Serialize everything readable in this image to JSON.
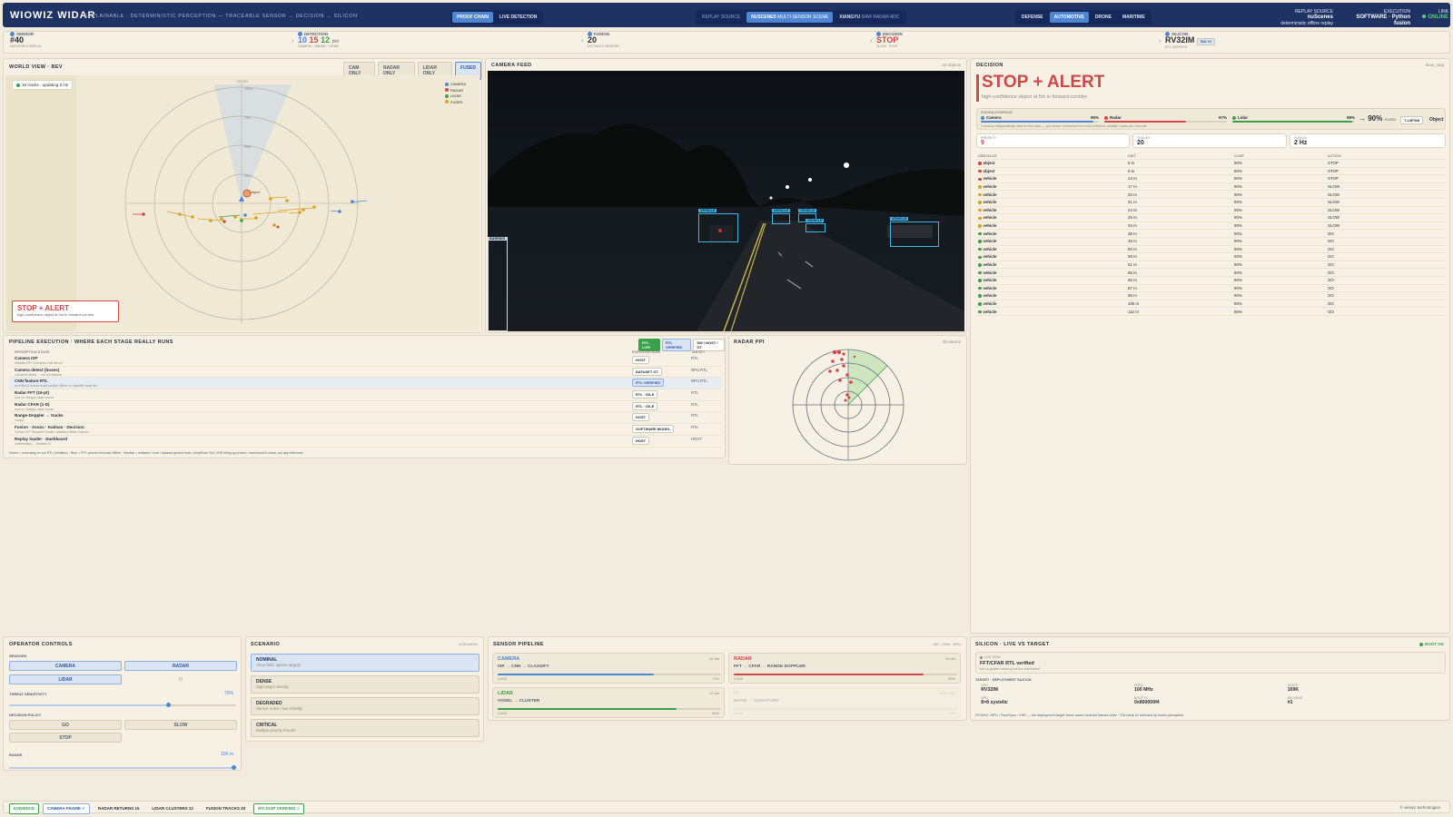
{
  "header": {
    "brand": "WIOWIZ WIDAR",
    "tagline": "EXPLAINABLE · DETERMINISTIC PERCEPTION — TRACEABLE SENSOR → DECISION → SILICON",
    "modes": [
      "PROOF CHAIN",
      "LIVE DETECTION"
    ],
    "replay_label": "REPLAY SOURCE",
    "replay": [
      "NUSCENES",
      "multi-sensor scene",
      "XIANGYU",
      "raw radar ADC"
    ],
    "domains": [
      "DEFENSE",
      "AUTOMOTIVE",
      "DRONE",
      "MARITIME"
    ],
    "replay_source": {
      "label": "REPLAY SOURCE",
      "value": "nuScenes",
      "sub": "deterministic offline replay"
    },
    "execution": {
      "label": "EXECUTION",
      "value": "SOFTWARE · Python fusion"
    },
    "link": {
      "label": "LINK",
      "value": "ONLINE"
    }
  },
  "chain": [
    {
      "label": "SENSOR",
      "value": "#40",
      "sub": "NUSCENES REPLAY"
    },
    {
      "label": "DETECTION",
      "v1": "10",
      "v2": "15",
      "v3": "12",
      "unit": "det",
      "sub": "CAMERA · RADAR · LIDAR"
    },
    {
      "label": "FUSION",
      "value": "20",
      "sub": "DST MULTI-SENSOR"
    },
    {
      "label": "DECISION",
      "value": "STOP",
      "sub": "SLOW · STOP"
    },
    {
      "label": "SILICON",
      "value": "RV32IM",
      "badge": "SIU #1",
      "sub": "RTL VERIFIED"
    }
  ],
  "world": {
    "title": "WORLD VIEW · BEV",
    "filters": [
      "CAM ONLY",
      "RADAR ONLY",
      "LIDAR ONLY",
      "FUSED"
    ],
    "status": "18 tracks · updating 2 Hz",
    "front": "FRONT",
    "rings": [
      "100m",
      "75m",
      "50m",
      "25m"
    ],
    "legend": [
      "CAMERA",
      "RADAR",
      "LIDAR",
      "FUSED"
    ],
    "alert": "STOP + ALERT",
    "alert_sub": "high-confidence object at 5m in forward corridor",
    "target": "object"
  },
  "camera": {
    "title": "CAMERA FEED",
    "count": "10 objects",
    "labels": [
      "VEHICLE",
      "VEHICLE",
      "VEHICLE",
      "VEHICLE",
      "VEHICLE",
      "BARRIER"
    ]
  },
  "decision": {
    "title": "DECISION",
    "tag": "slow_stop",
    "headline": "STOP + ALERT",
    "sub": "high-confidence object at 5m in forward corridor",
    "evidence_label": "FUSION EVIDENCE",
    "cam": "Camera",
    "cam_pct": "95%",
    "radar": "Radar",
    "radar_pct": "67%",
    "lidar": "Lidar",
    "lidar_pct": "98%",
    "fused": "90%",
    "fused_lbl": "FUSED",
    "track": "T-14f008",
    "obj": "Object",
    "note": "3 sensors independently observe this track — per-sensor confidence from real nuScenes visibility / radar pts / lidar pts",
    "stats": [
      {
        "l": "PRIORITY",
        "v": "9"
      },
      {
        "l": "TRACKS",
        "v": "20"
      },
      {
        "l": "FUSION",
        "v": "2 Hz"
      }
    ],
    "cols": [
      "OBSTACLE",
      "DIST",
      "CONF",
      "ACTION"
    ],
    "rows": [
      [
        "object",
        "6 m",
        "90%",
        "STOP"
      ],
      [
        "object",
        "8 m",
        "90%",
        "STOP"
      ],
      [
        "vehicle",
        "14 m",
        "90%",
        "STOP"
      ],
      [
        "vehicle",
        "17 m",
        "90%",
        "SLOW"
      ],
      [
        "vehicle",
        "20 m",
        "90%",
        "SLOW"
      ],
      [
        "vehicle",
        "21 m",
        "90%",
        "SLOW"
      ],
      [
        "vehicle",
        "24 m",
        "90%",
        "SLOW"
      ],
      [
        "vehicle",
        "25 m",
        "90%",
        "SLOW"
      ],
      [
        "vehicle",
        "34 m",
        "90%",
        "SLOW"
      ],
      [
        "vehicle",
        "38 m",
        "90%",
        "GO"
      ],
      [
        "vehicle",
        "45 m",
        "90%",
        "GO"
      ],
      [
        "vehicle",
        "50 m",
        "90%",
        "GO"
      ],
      [
        "vehicle",
        "56 m",
        "90%",
        "GO"
      ],
      [
        "vehicle",
        "61 m",
        "90%",
        "GO"
      ],
      [
        "vehicle",
        "65 m",
        "90%",
        "GO"
      ],
      [
        "vehicle",
        "66 m",
        "90%",
        "GO"
      ],
      [
        "vehicle",
        "87 m",
        "90%",
        "GO"
      ],
      [
        "vehicle",
        "96 m",
        "90%",
        "GO"
      ],
      [
        "vehicle",
        "105 m",
        "90%",
        "GO"
      ],
      [
        "vehicle",
        "112 m",
        "90%",
        "GO"
      ]
    ]
  },
  "pipeline": {
    "title": "PIPELINE EXECUTION · WHERE EACH STAGE REALLY RUNS",
    "badges": [
      "RTL LIVE",
      "RTL VERIFIED",
      "SW / HOST / GT"
    ],
    "cols": [
      "PERCEPTION STAGE",
      "EXECUTED NOW",
      "TARGET"
    ],
    "rows": [
      [
        "Camera ISP",
        "software ISP, nuScenes; real sensor",
        "HOST",
        "RTL"
      ],
      [
        "Camera detect (boxes)",
        "nuScenes labels → not run detector",
        "DATASET GT",
        "NPU RTL"
      ],
      [
        "CNN feature RTL",
        "conv/ReLU feature maps verified offline; no classifier head live",
        "RTL VERIFIED",
        "NPU RTL"
      ],
      [
        "Radar FFT (16-pt)",
        "runs on Xiangyu radar source",
        "RTL · IDLE",
        "RTL"
      ],
      [
        "Radar CFAR (1-D)",
        "runs on Xiangyu radar source",
        "RTL · IDLE",
        "RTL"
      ],
      [
        "Range-Doppler → tracks",
        "numpy",
        "HOST",
        "RTL"
      ],
      [
        "Fusion · Assoc · Kalman · Decision",
        "Python DST Dempster-Shafer; validated offline; Kalman",
        "SOFTWARE MODEL",
        "RTL"
      ],
      [
        "Replay loader · Dashboard",
        "orchestration → browser UI",
        "HOST",
        "HOST"
      ]
    ],
    "foot": "Green = executing on our RTL (Verilator) · Blue = RTL proven bit-exact offline · Neutral = software / host / dataset ground truth. DeepFuse SoC VHE bring-up proven: reset/clock/X-clean, not app inference."
  },
  "radar_ppi": {
    "title": "RADAR PPI",
    "count": "15 returns"
  },
  "controls": {
    "title": "OPERATOR CONTROLS",
    "sensors_lbl": "SENSORS",
    "sensors": [
      "CAMERA",
      "RADAR",
      "LIDAR",
      "IR"
    ],
    "threat_lbl": "THREAT SENSITIVITY",
    "threat": "70%",
    "threat_level": 0.7,
    "policy_lbl": "DECISION POLICY",
    "policy": [
      "GO",
      "SLOW",
      "STOP"
    ],
    "range_lbl": "RANGE",
    "range": "100 m",
    "range_level": 1.0
  },
  "scenario": {
    "title": "SCENARIO",
    "tag": "SCENARIO",
    "items": [
      {
        "n": "NOMINAL",
        "d": "Clear field, sparse targets"
      },
      {
        "n": "DENSE",
        "d": "High target density"
      },
      {
        "n": "DEGRADED",
        "d": "Sensor noise / low visibility"
      },
      {
        "n": "CRITICAL",
        "d": "Multiple priority threats"
      }
    ]
  },
  "sensor_pipeline": {
    "title": "SENSOR PIPELINE",
    "tag": "ISP · CNN · NPU",
    "cards": [
      {
        "n": "CAMERA",
        "c": "10 det",
        "p": "ISP → CNN → CLASSIFY",
        "l": "LOAD",
        "v": "70%",
        "lv": 0.7,
        "col": "#4f86d4"
      },
      {
        "n": "RADAR",
        "c": "15 det",
        "p": "FFT → CFAR → RANGE-DOPPLER",
        "l": "LOAD",
        "v": "85%",
        "lv": 0.85,
        "col": "#d04848"
      },
      {
        "n": "LIDAR",
        "c": "12 det",
        "p": "VOXEL → CLUSTER",
        "l": "LOAD",
        "v": "80%",
        "lv": 0.8,
        "col": "#3aa04a"
      },
      {
        "n": "IR",
        "c": "OFFLINE",
        "p": "BEAM → SIGNATURE",
        "l": "LOAD",
        "v": "0%",
        "lv": 0,
        "col": "#cfc8b3"
      }
    ]
  },
  "silicon": {
    "title": "SILICON · LIVE VS TARGET",
    "boot": "BOOT OK",
    "live_lbl": "LIVE NOW",
    "live": "FFT/CFAR RTL verified",
    "live_sub": "6/6 on golden vectors (not live this frame)",
    "target_lbl": "TARGET · DEPLOYMENT SILICON",
    "fields": [
      {
        "l": "CPU",
        "v": "RV32IM"
      },
      {
        "l": "FREQ",
        "v": "100 MHz"
      },
      {
        "l": "GATES",
        "v": "169K"
      },
      {
        "l": "NPU",
        "v": "8×8 systolic"
      },
      {
        "l": "BOOT PC",
        "v": "0x800000f4"
      },
      {
        "l": "SIU GRAD",
        "v": "#1"
      }
    ],
    "note": "RV32IM / NPU / FuseSync / VHE — the deployment target these same contract frames drive · SIU bank #1 selected by fused perception"
  },
  "footer": {
    "chips": [
      "EVIDENCE",
      "CAMERA FRAME ✓",
      "RADAR RETURNS 15",
      "LIDAR CLUSTERS 12",
      "FUSION TRACKS 20",
      "RTL/DSP VERIFIED ✓"
    ],
    "brand": "© wiowiz technologies"
  },
  "colors": {
    "navy": "#1e3264",
    "accent": "#4f86d4",
    "alert": "#d04848",
    "ok": "#3aa04a",
    "fused": "#e0a020"
  }
}
